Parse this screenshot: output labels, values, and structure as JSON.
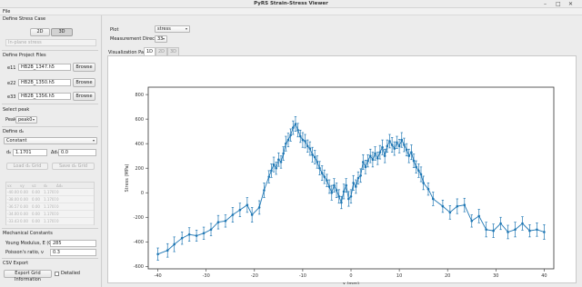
{
  "window": {
    "title": "PyRS Strain-Stress Viewer"
  },
  "menu": {
    "file": "File"
  },
  "left": {
    "stress_case": {
      "header": "Define Stress Case",
      "btn_2d": "2D",
      "btn_3d": "3D",
      "dropdown_placeholder": "In-plane stress"
    },
    "project_files": {
      "header": "Define Project Files",
      "rows": [
        {
          "label": "e11",
          "file": "HB2B_1347.h5",
          "browse": "Browse"
        },
        {
          "label": "e22",
          "file": "HB2B_1350.h5",
          "browse": "Browse"
        },
        {
          "label": "e33",
          "file": "HB2B_1356.h5",
          "browse": "Browse"
        }
      ]
    },
    "peak": {
      "header": "Select peak",
      "label": "Peak",
      "value": "peak0"
    },
    "d0": {
      "header": "Define d₀",
      "mode": "Constant",
      "d0_label": "d₀",
      "d0_value": "1.1701",
      "dd_label": "Δd₀",
      "dd_value": "0.0",
      "load_btn": "Load d₀ Grid",
      "save_btn": "Save d₀ Grid",
      "grid_headers": [
        "vx",
        "vy",
        "vz",
        "d₀",
        "Δd₀",
        ""
      ],
      "grid_rows": [
        [
          "-40.00",
          "0.00",
          "0.00",
          "1.1701",
          "0",
          ""
        ],
        [
          "-38.00",
          "0.00",
          "0.00",
          "1.1701",
          "0",
          ""
        ],
        [
          "-36.57",
          "0.00",
          "0.00",
          "1.1701",
          "0",
          ""
        ],
        [
          "-34.00",
          "0.00",
          "0.00",
          "1.1701",
          "0",
          ""
        ],
        [
          "-33.43",
          "0.00",
          "0.00",
          "1.1701",
          "0",
          ""
        ]
      ]
    },
    "mechanical": {
      "header": "Mechanical Constants",
      "youngs_label": "Young Modulus, E (GPa)",
      "youngs_value": "285",
      "poisson_label": "Poisson's ratio, ν",
      "poisson_value": "0.3"
    },
    "csv": {
      "header": "CSV Export",
      "export_btn": "Export Grid Information",
      "detailed_label": "Detailed"
    }
  },
  "right": {
    "plot_label": "Plot",
    "plot_value": "stress",
    "direction_label": "Measurement Direction",
    "direction_value": "33",
    "vis_label": "Visualization Pane",
    "tabs": [
      "1D",
      "2D",
      "3D"
    ]
  },
  "chart_data": {
    "type": "line",
    "xlabel": "x (mm)",
    "ylabel": "Stress (MPa)",
    "xlim": [
      -42,
      42
    ],
    "ylim": [
      -620,
      860
    ],
    "xticks": [
      -40,
      -30,
      -20,
      -10,
      0,
      10,
      20,
      30,
      40
    ],
    "yticks": [
      -600,
      -400,
      -200,
      0,
      200,
      400,
      600,
      800
    ],
    "grid": false,
    "color": "#1f77b4",
    "x": [
      -40,
      -38,
      -36.6,
      -35,
      -33.5,
      -32,
      -30.5,
      -29,
      -27.5,
      -26,
      -24.5,
      -23,
      -21.5,
      -20.5,
      -19,
      -18,
      -17,
      -16.5,
      -16,
      -15.5,
      -15,
      -14.5,
      -14,
      -13.5,
      -13,
      -12.5,
      -12,
      -11.5,
      -11,
      -10.5,
      -10,
      -9.5,
      -9,
      -8.5,
      -8,
      -7.5,
      -7,
      -6.5,
      -6,
      -5.5,
      -5,
      -4.5,
      -4,
      -3.5,
      -3,
      -2.5,
      -2,
      -1.5,
      -1,
      -0.5,
      0,
      0.5,
      1,
      1.5,
      2,
      2.5,
      3,
      3.5,
      4,
      4.5,
      5,
      5.5,
      6,
      6.5,
      7,
      7.5,
      8,
      8.5,
      9,
      9.5,
      10,
      10.5,
      11,
      11.5,
      12,
      12.5,
      13,
      13.5,
      14,
      14.5,
      15,
      16,
      17,
      19,
      20.5,
      22,
      23.5,
      25,
      26.5,
      28,
      29.5,
      31,
      32.5,
      34,
      35.5,
      37,
      38.5,
      40
    ],
    "values": [
      -500,
      -470,
      -420,
      -370,
      -340,
      -350,
      -330,
      -300,
      -240,
      -230,
      -180,
      -140,
      -100,
      -180,
      -120,
      20,
      130,
      180,
      230,
      200,
      270,
      250,
      320,
      400,
      430,
      470,
      530,
      560,
      510,
      460,
      430,
      420,
      380,
      360,
      310,
      290,
      250,
      200,
      160,
      130,
      100,
      50,
      0,
      60,
      20,
      -30,
      -80,
      10,
      60,
      -50,
      -30,
      80,
      50,
      120,
      140,
      250,
      210,
      260,
      300,
      270,
      320,
      280,
      330,
      370,
      300,
      380,
      420,
      390,
      360,
      410,
      380,
      430,
      390,
      350,
      300,
      330,
      260,
      210,
      180,
      150,
      80,
      30,
      -50,
      -110,
      -160,
      -110,
      -100,
      -230,
      -190,
      -300,
      -310,
      -250,
      -320,
      -300,
      -250,
      -310,
      -300,
      -320,
      -380,
      -390
    ],
    "errors": [
      50,
      55,
      60,
      50,
      55,
      45,
      50,
      50,
      55,
      50,
      60,
      55,
      60,
      60,
      55,
      60,
      50,
      55,
      60,
      50,
      55,
      50,
      55,
      60,
      55,
      50,
      55,
      60,
      55,
      50,
      60,
      55,
      50,
      55,
      60,
      55,
      50,
      55,
      60,
      55,
      50,
      55,
      60,
      55,
      60,
      55,
      50,
      60,
      55,
      60,
      55,
      60,
      55,
      50,
      55,
      60,
      55,
      50,
      55,
      60,
      55,
      50,
      55,
      60,
      55,
      50,
      55,
      60,
      55,
      50,
      55,
      60,
      55,
      50,
      55,
      60,
      55,
      50,
      55,
      60,
      55,
      50,
      55,
      50,
      55,
      60,
      55,
      50,
      55,
      60,
      55,
      50,
      55,
      60,
      55,
      50,
      55,
      60
    ]
  }
}
